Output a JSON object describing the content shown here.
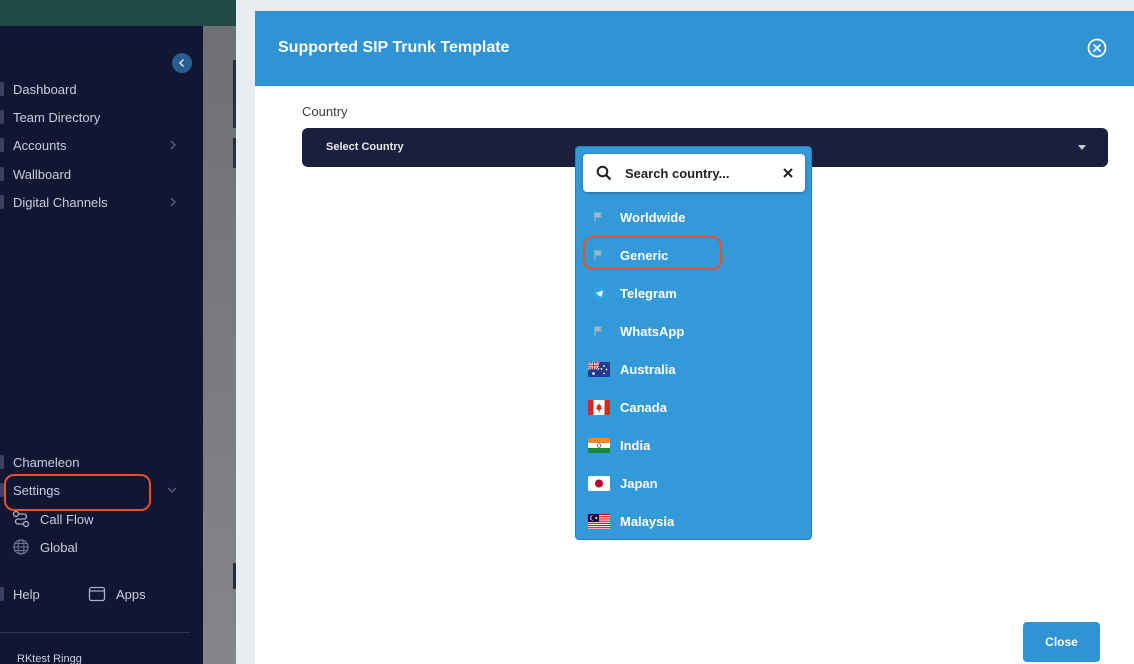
{
  "sidebar": {
    "items": [
      {
        "label": "Dashboard"
      },
      {
        "label": "Team Directory"
      },
      {
        "label": "Accounts"
      },
      {
        "label": "Wallboard"
      },
      {
        "label": "Digital Channels"
      },
      {
        "label": "Chameleon"
      },
      {
        "label": "Settings"
      }
    ],
    "sub_items": [
      {
        "label": "Call Flow",
        "icon": "route-icon"
      },
      {
        "label": "Global",
        "icon": "globe-icon"
      }
    ],
    "footer": {
      "help": "Help",
      "apps": "Apps"
    },
    "account_name": "RKtest Ringg"
  },
  "modal": {
    "title": "Supported SIP Trunk Template",
    "country_label": "Country",
    "select_placeholder": "Select Country",
    "close_label": "Close"
  },
  "dropdown": {
    "search_placeholder": "Search country...",
    "options": [
      {
        "label": "Worldwide",
        "flag": "generic-flag-icon"
      },
      {
        "label": "Generic",
        "flag": "generic-flag-icon"
      },
      {
        "label": "Telegram",
        "flag": "telegram-icon"
      },
      {
        "label": "WhatsApp",
        "flag": "generic-flag-icon"
      },
      {
        "label": "Australia",
        "flag": "australia-flag-icon"
      },
      {
        "label": "Canada",
        "flag": "canada-flag-icon"
      },
      {
        "label": "India",
        "flag": "india-flag-icon"
      },
      {
        "label": "Japan",
        "flag": "japan-flag-icon"
      },
      {
        "label": "Malaysia",
        "flag": "malaysia-flag-icon"
      }
    ]
  },
  "colors": {
    "accent": "#2f93d4",
    "highlight": "#e8502a",
    "sidebar_bg": "#111633",
    "select_bg": "#1a1f3d"
  }
}
